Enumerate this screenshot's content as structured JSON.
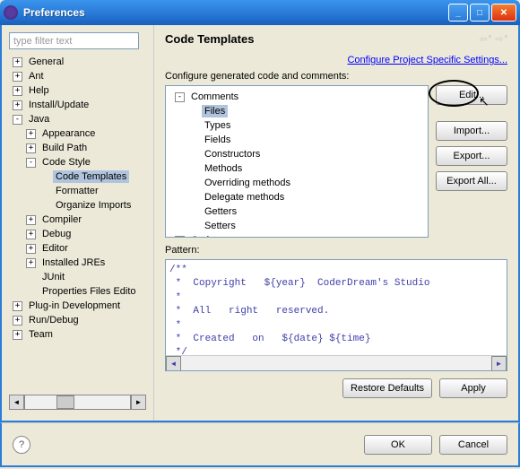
{
  "window": {
    "title": "Preferences"
  },
  "filter": {
    "placeholder": "type filter text"
  },
  "nav_tree": [
    {
      "label": "General",
      "exp": "+",
      "depth": 0
    },
    {
      "label": "Ant",
      "exp": "+",
      "depth": 0
    },
    {
      "label": "Help",
      "exp": "+",
      "depth": 0
    },
    {
      "label": "Install/Update",
      "exp": "+",
      "depth": 0
    },
    {
      "label": "Java",
      "exp": "-",
      "depth": 0
    },
    {
      "label": "Appearance",
      "exp": "+",
      "depth": 1
    },
    {
      "label": "Build Path",
      "exp": "+",
      "depth": 1
    },
    {
      "label": "Code Style",
      "exp": "-",
      "depth": 1
    },
    {
      "label": "Code Templates",
      "exp": "",
      "depth": 2,
      "selected": true
    },
    {
      "label": "Formatter",
      "exp": "",
      "depth": 2
    },
    {
      "label": "Organize Imports",
      "exp": "",
      "depth": 2
    },
    {
      "label": "Compiler",
      "exp": "+",
      "depth": 1
    },
    {
      "label": "Debug",
      "exp": "+",
      "depth": 1
    },
    {
      "label": "Editor",
      "exp": "+",
      "depth": 1
    },
    {
      "label": "Installed JREs",
      "exp": "+",
      "depth": 1
    },
    {
      "label": "JUnit",
      "exp": "",
      "depth": 1
    },
    {
      "label": "Properties Files Edito",
      "exp": "",
      "depth": 1
    },
    {
      "label": "Plug-in Development",
      "exp": "+",
      "depth": 0
    },
    {
      "label": "Run/Debug",
      "exp": "+",
      "depth": 0
    },
    {
      "label": "Team",
      "exp": "+",
      "depth": 0
    }
  ],
  "page": {
    "title": "Code Templates",
    "link": "Configure Project Specific Settings...",
    "section_label": "Configure generated code and comments:",
    "pattern_label": "Pattern:"
  },
  "template_tree": [
    {
      "label": "Comments",
      "exp": "-",
      "depth": 0
    },
    {
      "label": "Files",
      "exp": "",
      "depth": 1,
      "selected": true
    },
    {
      "label": "Types",
      "exp": "",
      "depth": 1
    },
    {
      "label": "Fields",
      "exp": "",
      "depth": 1
    },
    {
      "label": "Constructors",
      "exp": "",
      "depth": 1
    },
    {
      "label": "Methods",
      "exp": "",
      "depth": 1
    },
    {
      "label": "Overriding methods",
      "exp": "",
      "depth": 1
    },
    {
      "label": "Delegate methods",
      "exp": "",
      "depth": 1
    },
    {
      "label": "Getters",
      "exp": "",
      "depth": 1
    },
    {
      "label": "Setters",
      "exp": "",
      "depth": 1
    },
    {
      "label": "Code",
      "exp": "+",
      "depth": 0
    }
  ],
  "buttons": {
    "edit": "Edit...",
    "import": "Import...",
    "export": "Export...",
    "export_all": "Export All...",
    "restore": "Restore Defaults",
    "apply": "Apply",
    "ok": "OK",
    "cancel": "Cancel"
  },
  "pattern_text": "/**\n *  Copyright   ${year}  CoderDream's Studio\n *\n *  All   right   reserved.\n *\n *  Created   on   ${date} ${time}\n */"
}
